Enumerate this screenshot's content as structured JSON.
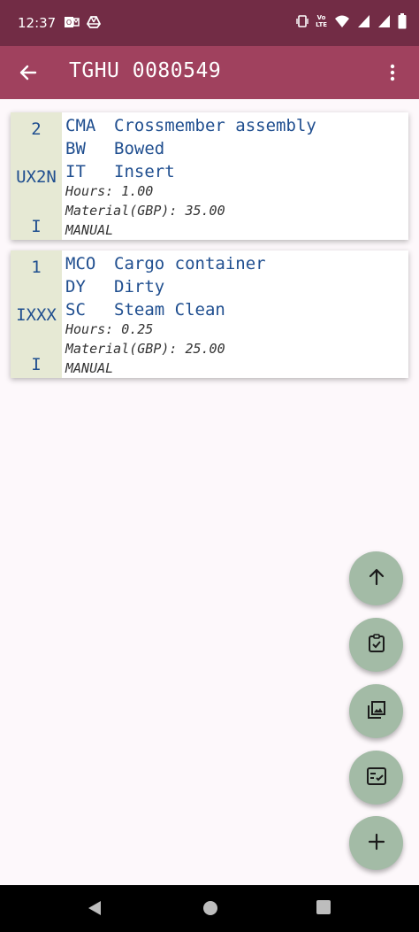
{
  "status_bar": {
    "time": "12:37",
    "left_icons": [
      "outlook-icon",
      "drive-icon"
    ],
    "right_icons": [
      "vibrate-icon",
      "volte-icon",
      "wifi-icon",
      "signal-icon",
      "signal-icon",
      "battery-icon"
    ],
    "volte_top": "Vo",
    "volte_bottom": "LTE"
  },
  "app_bar": {
    "title": "TGHU 0080549",
    "back_icon": "arrow-back-icon",
    "menu_icon": "more-vert-icon"
  },
  "repairs": [
    {
      "quantity": "2",
      "location": "UX2N",
      "tag": "I",
      "lines": [
        {
          "code": "CMA",
          "desc": "Crossmember assembly"
        },
        {
          "code": "BW",
          "desc": "Bowed"
        },
        {
          "code": "IT",
          "desc": "Insert"
        }
      ],
      "hours": "Hours: 1.00",
      "material": "Material(GBP): 35.00",
      "mode": "MANUAL"
    },
    {
      "quantity": "1",
      "location": "IXXX",
      "tag": "I",
      "lines": [
        {
          "code": "MCO",
          "desc": "Cargo container"
        },
        {
          "code": "DY",
          "desc": "Dirty"
        },
        {
          "code": "SC",
          "desc": "Steam Clean"
        }
      ],
      "hours": "Hours: 0.25",
      "material": "Material(GBP): 25.00",
      "mode": "MANUAL"
    }
  ],
  "fabs": [
    "arrow-up-icon",
    "clipboard-check-icon",
    "photo-library-icon",
    "checklist-icon",
    "add-icon"
  ],
  "colors": {
    "status_bar": "#722c45",
    "app_bar": "#a0415e",
    "card_side": "#e6e9d4",
    "text_blue": "#1f4e8f",
    "fab": "#a3bba6"
  }
}
